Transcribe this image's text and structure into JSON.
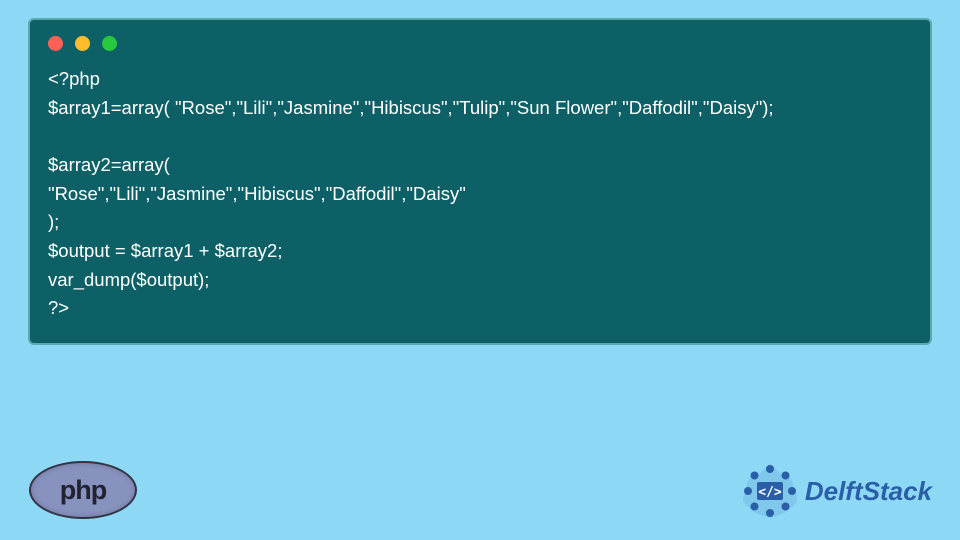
{
  "code": {
    "line1": "<?php",
    "line2": "$array1=array( \"Rose\",\"Lili\",\"Jasmine\",\"Hibiscus\",\"Tulip\",\"Sun Flower\",\"Daffodil\",\"Daisy\");",
    "line3": "",
    "line4": "$array2=array(",
    "line5": "\"Rose\",\"Lili\",\"Jasmine\",\"Hibiscus\",\"Daffodil\",\"Daisy\"",
    "line6": ");",
    "line7": "$output = $array1 + $array2;",
    "line8": "var_dump($output);",
    "line9": "?>"
  },
  "logos": {
    "php": "php",
    "delft": "DelftStack"
  },
  "colors": {
    "page_bg": "#8cd8f5",
    "window_bg": "#0d6066",
    "window_border": "#5ba8ad",
    "code_text": "#ffffff",
    "php_bg": "#8892bf",
    "delft_blue": "#2a5fa8"
  }
}
